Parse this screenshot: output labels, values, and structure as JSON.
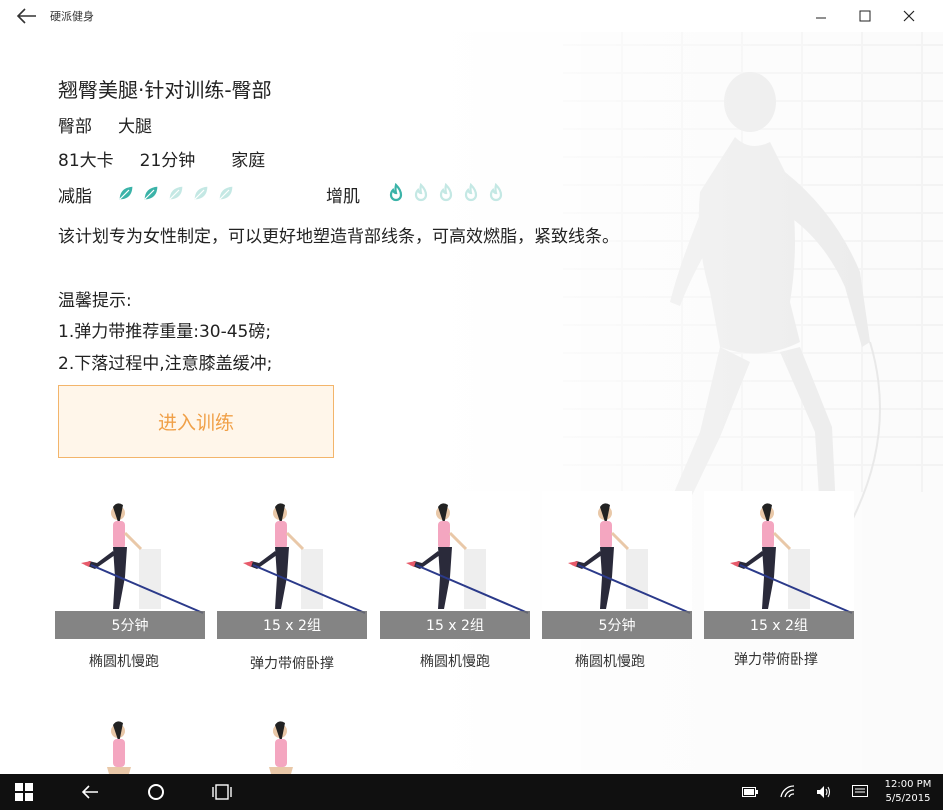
{
  "window": {
    "title": "硬派健身"
  },
  "plan": {
    "title": "翘臀美腿·针对训练-臀部",
    "tags": [
      "臀部",
      "大腿"
    ],
    "calories": "81大卡",
    "duration": "21分钟",
    "location": "家庭",
    "fat_loss": {
      "label": "减脂",
      "level": 2,
      "max": 5
    },
    "muscle_gain": {
      "label": "增肌",
      "level": 1,
      "max": 5
    },
    "description": "该计划专为女性制定，可以更好地塑造背部线条，可高效燃脂，紧致线条。",
    "tips_title": "温馨提示:",
    "tips": [
      "1.弹力带推荐重量:30-45磅;",
      "2.下落过程中,注意膝盖缓冲;"
    ],
    "enter_button": "进入训练"
  },
  "exercises": [
    {
      "badge": "5分钟",
      "name": "椭圆机慢跑"
    },
    {
      "badge": "15 x 2组",
      "name": "弹力带俯卧撑"
    },
    {
      "badge": "15 x 2组",
      "name": "椭圆机慢跑"
    },
    {
      "badge": "5分钟",
      "name": "椭圆机慢跑"
    },
    {
      "badge": "15 x 2组",
      "name": "弹力带俯卧撑"
    }
  ],
  "colors": {
    "accent": "#3bb3a8",
    "accent_light": "#bfe6e2",
    "button_orange": "#f0a048",
    "taskbar": "#101010"
  },
  "taskbar": {
    "icons": [
      "windows-icon",
      "back-icon",
      "cortana-icon",
      "task-view-icon",
      "battery-icon",
      "wifi-icon",
      "volume-icon",
      "notification-icon"
    ],
    "time": "12:00 PM",
    "date": "5/5/2015"
  }
}
